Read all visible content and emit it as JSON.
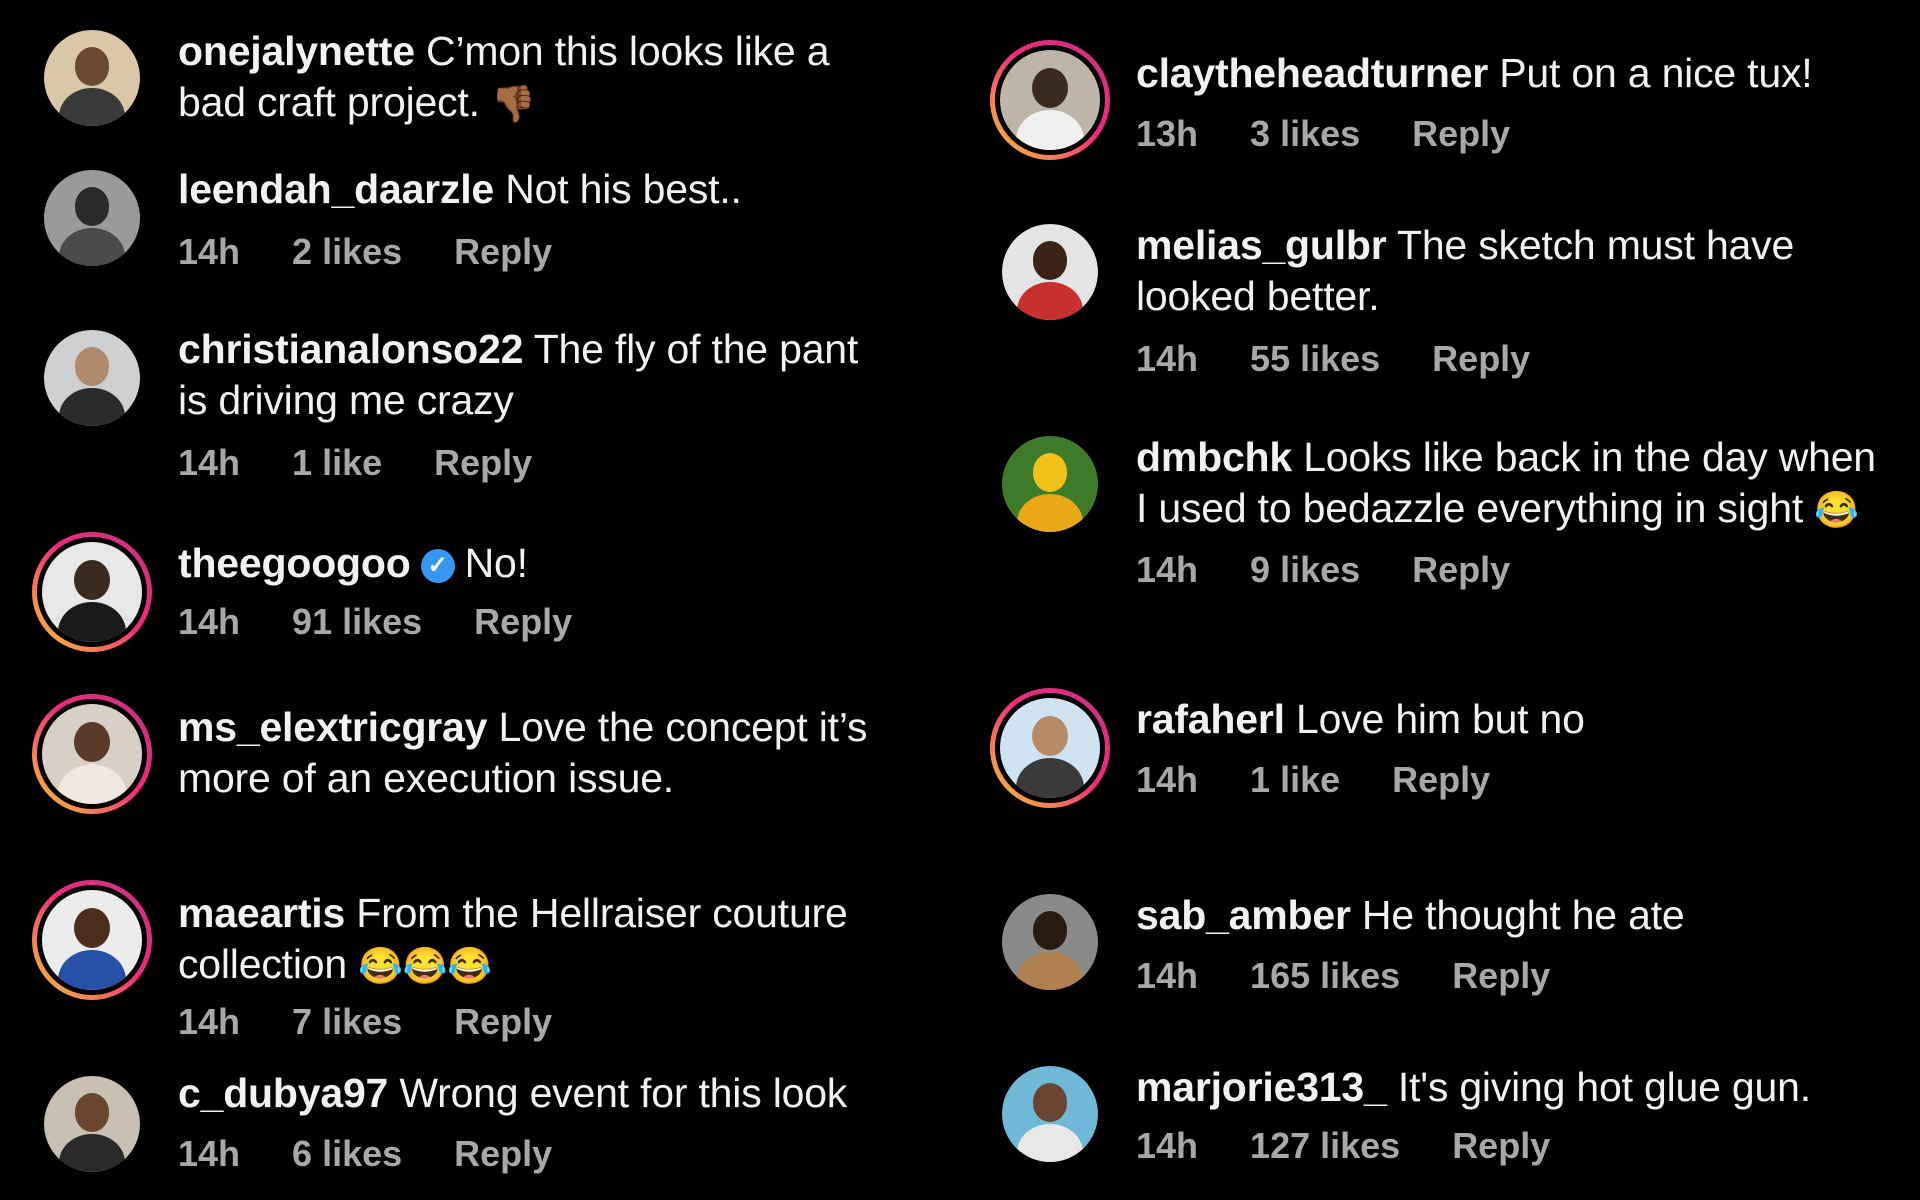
{
  "left_column": [
    {
      "username": "onejalynette",
      "text": "C’mon this looks like a bad craft project.",
      "emoji": "👎🏾",
      "time": "",
      "likes": "",
      "reply": ""
    },
    {
      "username": "leendah_daarzle",
      "text": "Not his best..",
      "time": "14h",
      "likes": "2 likes",
      "reply": "Reply"
    },
    {
      "username": "christianalonso22",
      "text": "The fly of the pant is driving me crazy",
      "time": "14h",
      "likes": "1 like",
      "reply": "Reply"
    },
    {
      "username": "theegoogoo",
      "verified": true,
      "text": "No!",
      "time": "14h",
      "likes": "91 likes",
      "reply": "Reply"
    },
    {
      "username": "ms_elextricgray",
      "text": "Love the concept it’s more of an execution issue.",
      "time": "",
      "likes": "",
      "reply": ""
    },
    {
      "username": "maeartis",
      "text": "From the Hellraiser couture collection",
      "emoji": "😂😂😂",
      "time": "14h",
      "likes": "7 likes",
      "reply": "Reply"
    },
    {
      "username": "c_dubya97",
      "text": "Wrong event for this look",
      "time": "14h",
      "likes": "6 likes",
      "reply": "Reply"
    }
  ],
  "right_column": [
    {
      "username": "claytheheadturner",
      "text": "Put on a nice tux!",
      "time": "13h",
      "likes": "3 likes",
      "reply": "Reply"
    },
    {
      "username": "melias_gulbr",
      "text": "The sketch must have looked better.",
      "time": "14h",
      "likes": "55 likes",
      "reply": "Reply"
    },
    {
      "username": "dmbchk",
      "text": "Looks like back in the day when I used to bedazzle everything in sight",
      "emoji": "😂",
      "time": "14h",
      "likes": "9 likes",
      "reply": "Reply"
    },
    {
      "username": "rafaherl",
      "text": "Love him but no",
      "time": "14h",
      "likes": "1 like",
      "reply": "Reply"
    },
    {
      "username": "sab_amber",
      "text": "He thought he ate",
      "time": "14h",
      "likes": "165 likes",
      "reply": "Reply"
    },
    {
      "username": "marjorie313_",
      "text": "It's giving hot glue gun.",
      "time": "14h",
      "likes": "127 likes",
      "reply": "Reply"
    }
  ],
  "colors": {
    "background": "#000000",
    "text": "#f2f2f2",
    "meta": "#a8a8a8",
    "verified": "#3897f0",
    "story_ring_start": "#f9ce34",
    "story_ring_end": "#c13584"
  },
  "icons": {
    "verified": "verified-badge-icon"
  }
}
